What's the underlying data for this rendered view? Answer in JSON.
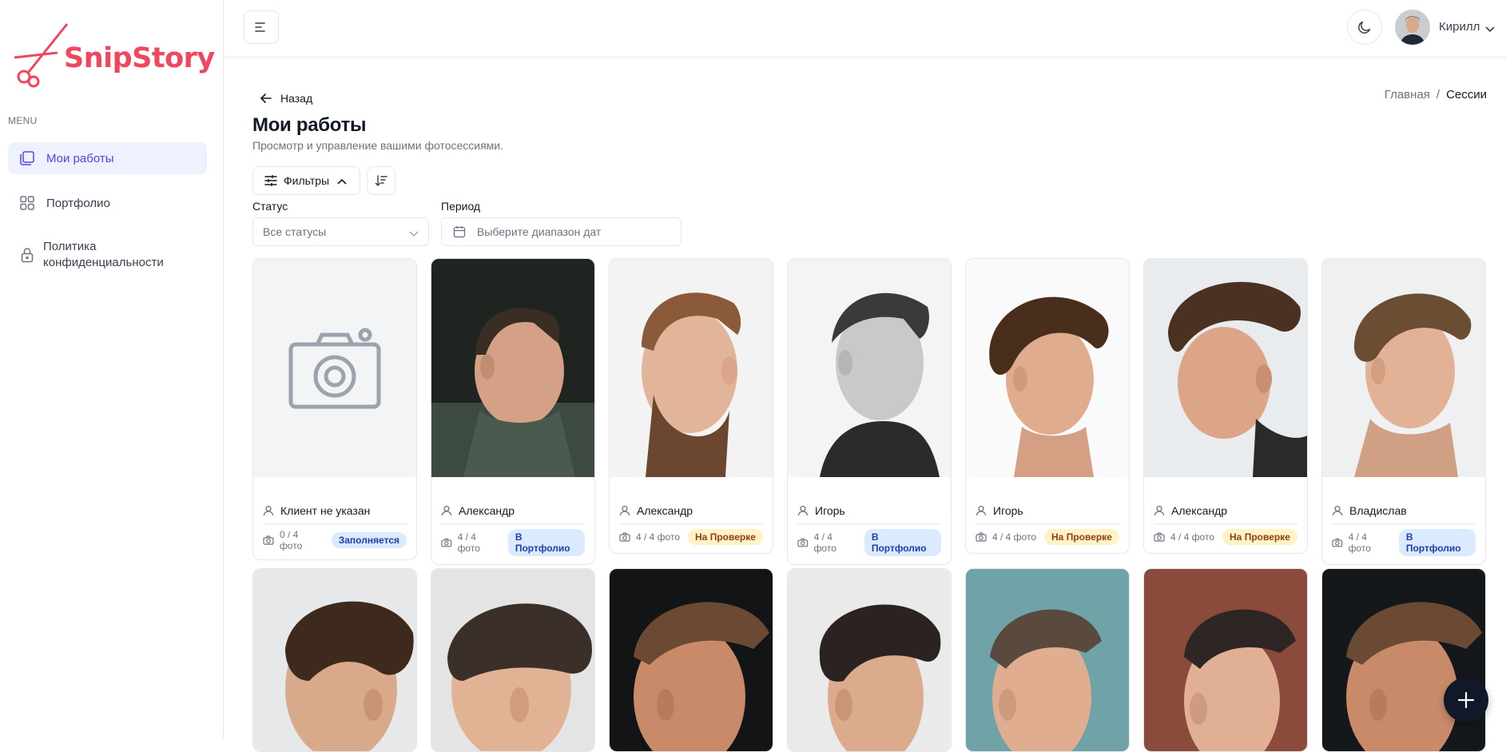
{
  "brand": {
    "name": "SnipStory",
    "color": "#f0475f"
  },
  "sidebar": {
    "menu_label": "MENU",
    "items": [
      {
        "label": "Мои работы",
        "icon": "gallery-icon",
        "active": true
      },
      {
        "label": "Портфолио",
        "icon": "grid-icon",
        "active": false
      },
      {
        "label": "Политика конфиденциальности",
        "icon": "lock-icon",
        "active": false
      }
    ]
  },
  "topbar": {
    "user_name": "Кирилл"
  },
  "header": {
    "back_label": "Назад",
    "breadcrumb": {
      "home": "Главная",
      "separator": "/",
      "current": "Сессии"
    },
    "title": "Мои работы",
    "subtitle": "Просмотр и управление вашими фотосессиями."
  },
  "filters": {
    "toggle_label": "Фильтры",
    "status_label": "Статус",
    "status_value": "Все статусы",
    "period_label": "Период",
    "period_placeholder": "Выберите диапазон дат"
  },
  "sessions": [
    {
      "client": "Клиент не указан",
      "photos": "0 / 4 фото",
      "status": "Заполняется",
      "status_color": "blue",
      "image": "camera-placeholder"
    },
    {
      "client": "Александр",
      "photos": "4 / 4 фото",
      "status": "В Портфолио",
      "status_color": "blue",
      "image": "man-side-profile-short-fade"
    },
    {
      "client": "Александр",
      "photos": "4 / 4 фото",
      "status": "На Проверке",
      "status_color": "yellow",
      "image": "man-beard-side-profile"
    },
    {
      "client": "Игорь",
      "photos": "4 / 4 фото",
      "status": "В Портфолио",
      "status_color": "blue",
      "image": "man-grayscale-side-profile"
    },
    {
      "client": "Игорь",
      "photos": "4 / 4 фото",
      "status": "На Проверке",
      "status_color": "yellow",
      "image": "man-wavy-hair-side-profile"
    },
    {
      "client": "Александр",
      "photos": "4 / 4 фото",
      "status": "На Проверке",
      "status_color": "yellow",
      "image": "man-pompadour-side-profile"
    },
    {
      "client": "Владислав",
      "photos": "4 / 4 фото",
      "status": "В Портфолио",
      "status_color": "blue",
      "image": "man-side-part-profile"
    }
  ],
  "sessions_row2": [
    {
      "image": "man-back-swept-hair"
    },
    {
      "image": "man-back-taper-fade"
    },
    {
      "image": "man-skin-fade-profile"
    },
    {
      "image": "man-textured-crop-profile"
    },
    {
      "image": "man-high-fade-profile"
    },
    {
      "image": "man-crop-fade-brick-wall"
    },
    {
      "image": "man-skin-fade-profile-2"
    }
  ]
}
